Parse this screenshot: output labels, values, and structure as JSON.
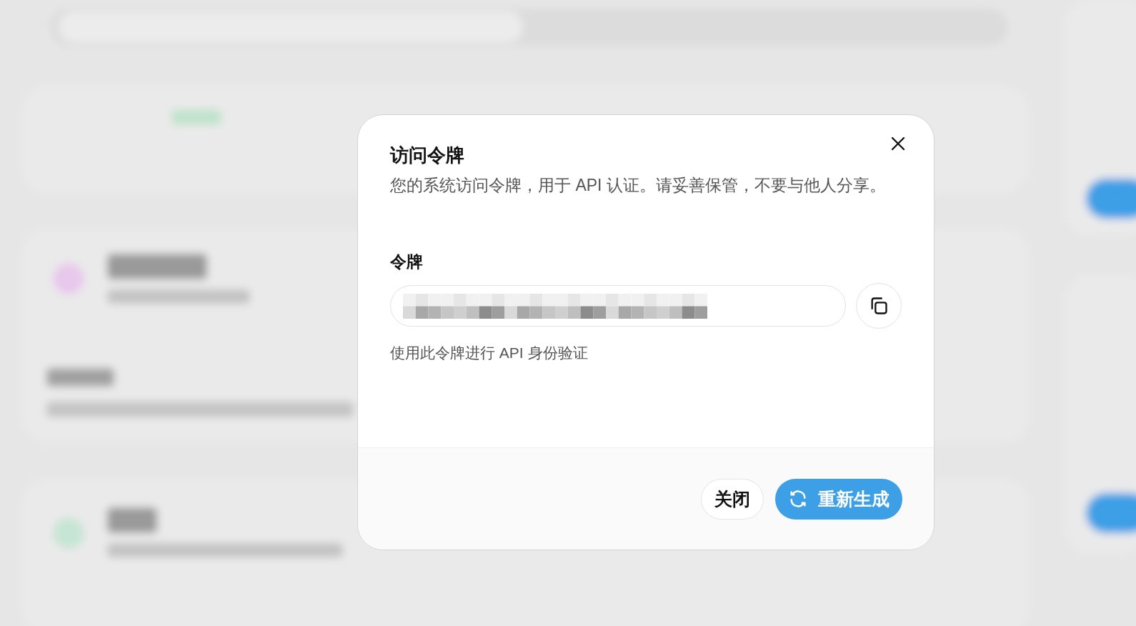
{
  "dialog": {
    "title": "访问令牌",
    "description": "您的系统访问令牌，用于 API 认证。请妥善保管，不要与他人分享。",
    "token_field": {
      "label": "令牌",
      "hint": "使用此令牌进行 API 身份验证"
    },
    "buttons": [
      {
        "label": "关闭",
        "kind": "secondary"
      },
      {
        "label": "重新生成",
        "kind": "primary"
      }
    ]
  }
}
